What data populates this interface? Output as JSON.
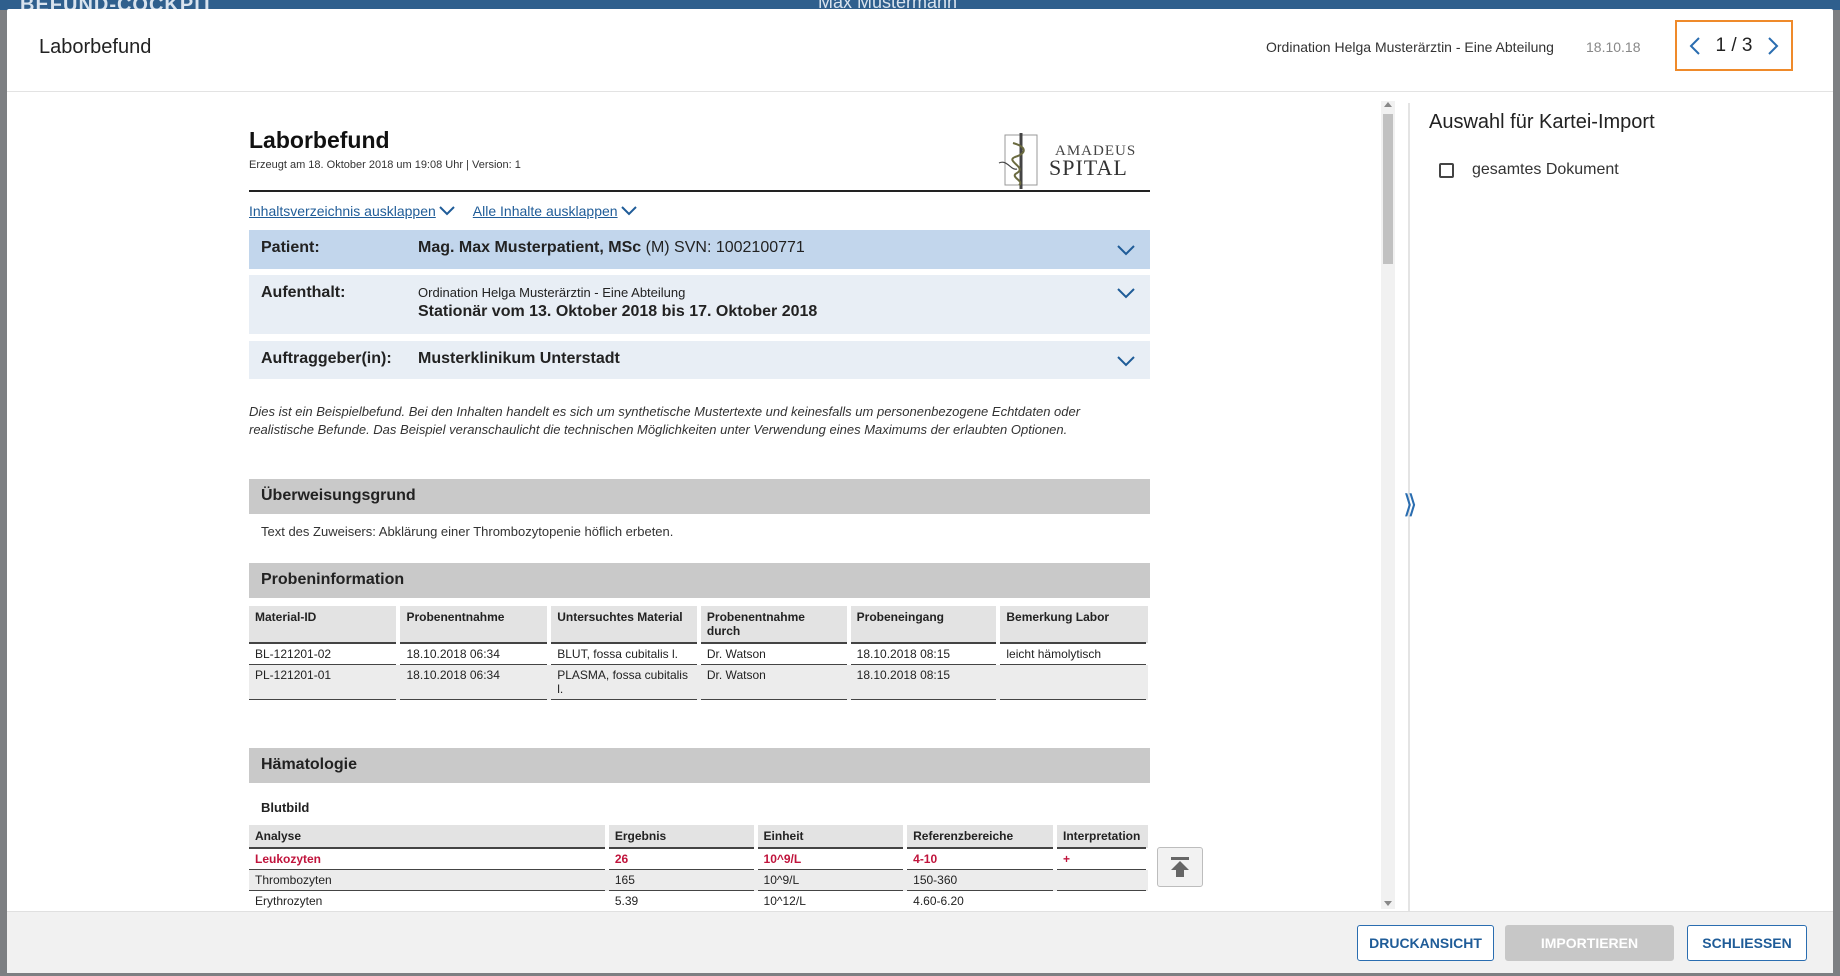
{
  "backdrop": {
    "app_title": "BEFUND-COCKPIT",
    "user_name": "Max Mustermann"
  },
  "header": {
    "title": "Laborbefund",
    "organization": "Ordination Helga Musterärztin - Eine Abteilung",
    "date": "18.10.18",
    "pager": "1 / 3"
  },
  "document": {
    "title": "Laborbefund",
    "subtitle": "Erzeugt am 18. Oktober 2018 um 19:08 Uhr | Version: 1",
    "logo_text_top": "AMADEUS",
    "logo_text_bottom": "SPITAL",
    "toc_link": "Inhaltsverzeichnis ausklappen",
    "all_link": "Alle Inhalte ausklappen",
    "patient": {
      "label": "Patient:",
      "name": "Mag. Max Musterpatient, MSc",
      "sex": "(M)",
      "svn": "SVN: 1002100771"
    },
    "stay": {
      "label": "Aufenthalt:",
      "org": "Ordination Helga Musterärztin - Eine Abteilung",
      "period": "Stationär vom 13. Oktober 2018 bis 17. Oktober 2018"
    },
    "orderer": {
      "label": "Auftraggeber(in):",
      "value": "Musterklinikum Unterstadt"
    },
    "disclaimer": "Dies ist ein Beispielbefund. Bei den Inhalten handelt es sich um synthetische Mustertexte und keinesfalls um personenbezogene Echtdaten oder realistische Befunde. Das Beispiel veranschaulicht die technischen Möglichkeiten unter Verwendung eines Maximums der erlaubten Optionen.",
    "referral": {
      "heading": "Überweisungsgrund",
      "text": "Text des Zuweisers: Abklärung einer Thrombozytopenie höflich erbeten."
    },
    "samples": {
      "heading": "Probeninformation",
      "columns": [
        "Material-ID",
        "Probenentnahme",
        "Untersuchtes Material",
        "Probenentnahme durch",
        "Probeneingang",
        "Bemerkung Labor"
      ],
      "rows": [
        [
          "BL-121201-02",
          "18.10.2018 06:34",
          "BLUT, fossa cubitalis l.",
          "Dr. Watson",
          "18.10.2018 08:15",
          "leicht hämolytisch"
        ],
        [
          "PL-121201-01",
          "18.10.2018 06:34",
          "PLASMA, fossa cubitalis l.",
          "Dr. Watson",
          "18.10.2018 08:15",
          ""
        ]
      ]
    },
    "hematology": {
      "heading": "Hämatologie",
      "subheading": "Blutbild",
      "columns": [
        "Analyse",
        "Ergebnis",
        "Einheit",
        "Referenzbereiche",
        "Interpretation"
      ],
      "rows": [
        [
          "Leukozyten",
          "26",
          "10^9/L",
          "4-10",
          "+"
        ],
        [
          "Thrombozyten",
          "165",
          "10^9/L",
          "150-360",
          ""
        ],
        [
          "Erythrozyten",
          "5.39",
          "10^12/L",
          "4.60-6.20",
          ""
        ]
      ]
    }
  },
  "side": {
    "title": "Auswahl für Kartei-Import",
    "checkbox_label": "gesamtes Dokument"
  },
  "footer": {
    "print": "DRUCKANSICHT",
    "import": "IMPORTIEREN",
    "close": "SCHLIESSEN"
  },
  "colors": {
    "accent": "#2a6db0",
    "highlight": "#ef8a2a",
    "abnormal": "#c0143c"
  }
}
